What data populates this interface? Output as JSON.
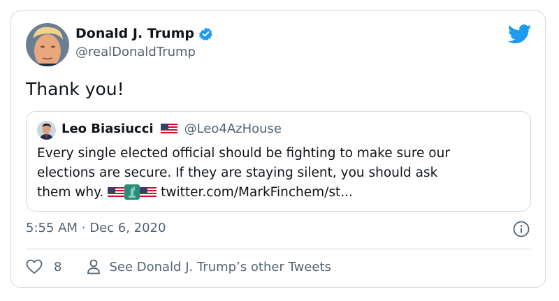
{
  "author": {
    "name": "Donald J. Trump",
    "handle": "@realDonaldTrump"
  },
  "tweet": {
    "text": "Thank you!",
    "time": "5:55 AM",
    "separator": "·",
    "date": "Dec 6, 2020"
  },
  "quoted": {
    "name": "Leo Biasiucci",
    "handle": "@Leo4AzHouse",
    "text_line1": "Every single elected official should be fighting to make sure our",
    "text_line2": "elections are secure. If they are staying silent, you should ask",
    "text_line3_prefix": "them why.",
    "link": "twitter.com/MarkFinchem/st..."
  },
  "actions": {
    "like_count": "8",
    "other_tweets_label": "See Donald J. Trump’s other Tweets"
  },
  "colors": {
    "verified": "#1d9bf0",
    "twitter_blue": "#1d9bf0",
    "muted_text": "#536471",
    "border": "#cfd9de"
  },
  "icons": [
    "twitter-bird-icon",
    "verified-badge-icon",
    "us-flag-icon",
    "statue-of-liberty-icon",
    "info-icon",
    "heart-icon",
    "person-icon"
  ]
}
